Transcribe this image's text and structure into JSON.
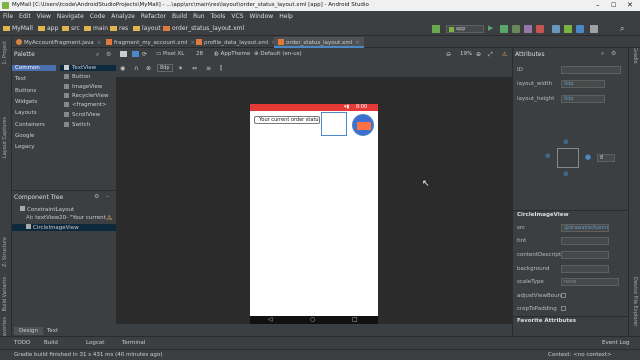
{
  "window": {
    "title": "MyMall [C:\\Users\\tcode\\AndroidStudioProjects\\MyMall] - ...\\app\\src\\main\\res\\layout\\order_status_layout.xml [app] - Android Studio"
  },
  "menu": [
    "File",
    "Edit",
    "View",
    "Navigate",
    "Code",
    "Analyze",
    "Refactor",
    "Build",
    "Run",
    "Tools",
    "VCS",
    "Window",
    "Help"
  ],
  "breadcrumb": [
    "MyMall",
    "app",
    "src",
    "main",
    "res",
    "layout",
    "order_status_layout.xml"
  ],
  "run_config": "app",
  "tabs": [
    {
      "label": "MyAccountFragment.java"
    },
    {
      "label": "fragment_my_account.xml"
    },
    {
      "label": "profile_data_layout.xml"
    },
    {
      "label": "order_status_layout.xml"
    }
  ],
  "design_toolbar": {
    "dp": "8dp",
    "device": "Pixel XL",
    "api": "28",
    "theme": "AppTheme",
    "locale": "Default (en-us)",
    "zoom": "19%"
  },
  "palette": {
    "title": "Palette",
    "categories": [
      "Common",
      "Text",
      "Buttons",
      "Widgets",
      "Layouts",
      "Containers",
      "Google",
      "Legacy"
    ],
    "items": [
      "TextView",
      "Button",
      "ImageView",
      "RecyclerView",
      "<fragment>",
      "ScrollView",
      "Switch"
    ]
  },
  "component_tree": {
    "title": "Component Tree",
    "root": "ConstraintLayout",
    "children": [
      "textView20- \"Your current ...",
      "CircleImageView"
    ]
  },
  "phone": {
    "time": "8:00",
    "text": "Your current order status"
  },
  "attributes": {
    "title": "Attributes",
    "id_label": "ID",
    "layout_width": "layout_width",
    "layout_width_val": "0dp",
    "layout_height": "layout_height",
    "layout_height_val": "0dp",
    "margin_val": "8",
    "section": "CircleImageView",
    "src_label": "src",
    "src_val": "@drawable/banne",
    "tint_label": "tint",
    "content_label": "contentDescripti",
    "background_label": "background",
    "scale_label": "scaleType",
    "scale_val": "none",
    "adjust_label": "adjustViewBoun",
    "crop_label": "cropToPadding",
    "favorite": "Favorite Attributes"
  },
  "bottom": {
    "design": "Design",
    "text": "Text",
    "todo": "TODO",
    "build": "Build",
    "logcat": "Logcat",
    "terminal": "Terminal",
    "event_log": "Event Log"
  },
  "status": {
    "message": "Gradle build finished in 31 s 431 ms (40 minutes ago)",
    "context": "Context: <no context>"
  },
  "colors": {
    "accent": "#4a88c7",
    "status_red": "#e53935"
  }
}
